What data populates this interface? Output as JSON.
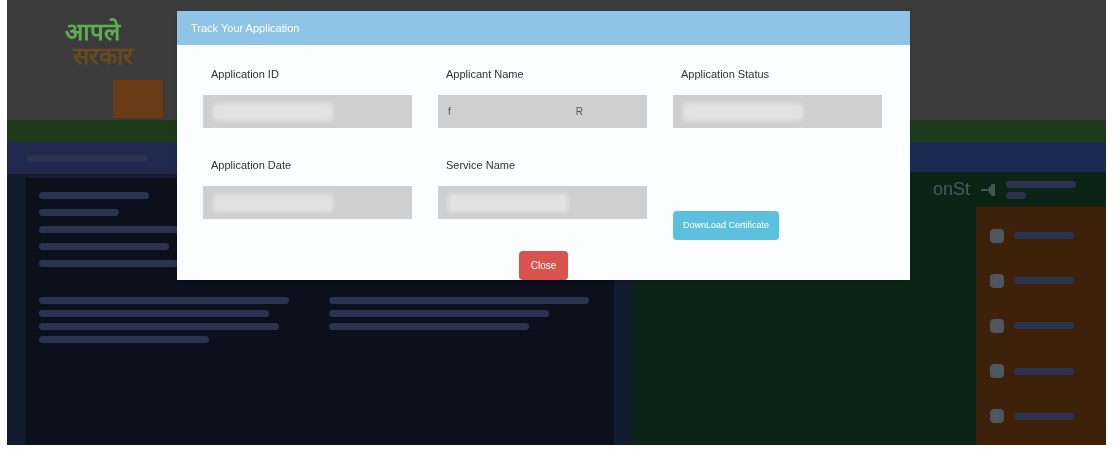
{
  "logo": {
    "line_1": "आपले",
    "line_2": "सरकार"
  },
  "side_text": "onSt",
  "modal": {
    "title": "Track Your Application",
    "fields": [
      {
        "label": "Application ID",
        "redacted": true
      },
      {
        "label": "Applicant Name",
        "redacted": false,
        "value_parts": [
          "f",
          "R"
        ]
      },
      {
        "label": "Application Status",
        "redacted": true
      },
      {
        "label": "Application Date",
        "redacted": true
      },
      {
        "label": "Service Name",
        "redacted": true
      }
    ],
    "download_button": "DownLoad Certificate",
    "close_button": "Close"
  }
}
